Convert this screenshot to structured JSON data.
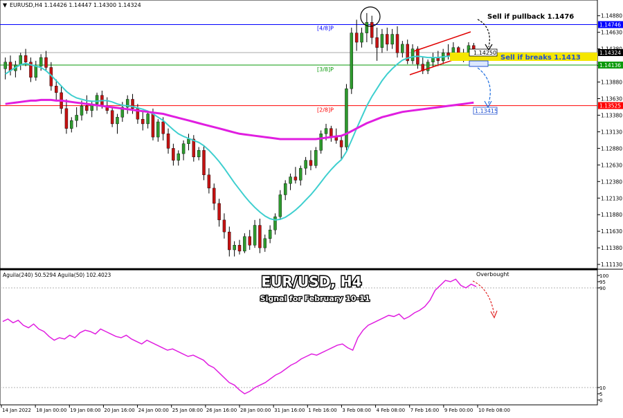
{
  "colors": {
    "bull": "#2e9a2e",
    "bear": "#c41212",
    "ema_fast": "#3ecfcf",
    "ema_slow": "#e01ee0",
    "oscillator": "#e01ee0",
    "level_48": "#0000ff",
    "level_38": "#0a9a0a",
    "level_28": "#ff0000",
    "price_badge": "#000000",
    "highlight_yellow": "#f5e600",
    "channel": "#e00000"
  },
  "header": {
    "symbol_line": "EURUSD,H4  1.14426 1.14447 1.14300 1.14324"
  },
  "title": {
    "main": "EUR/USD, H4",
    "sub": "Signal for February 10-11"
  },
  "annotations": {
    "sell_pullback": "Sell if pullback 1.1476",
    "sell_break": "Sell if breaks 1.1413",
    "target_box": "1.14250",
    "target2_box": "1.13415",
    "overbought": "Overbought",
    "label_48": "[4/8]P",
    "label_38": "[3/8]P",
    "label_28": "[2/8]P"
  },
  "indicator": {
    "legend": "Aguila(240) 50.5294 Aguila(50) 102.4023"
  },
  "chart_data": [
    {
      "type": "candlestick",
      "name": "EURUSD H4 price",
      "ylim": [
        1.1111,
        1.1495
      ],
      "yticks": [
        "1.14880",
        "1.14630",
        "1.14380",
        "1.14130",
        "1.13880",
        "1.13630",
        "1.13380",
        "1.13130",
        "1.12880",
        "1.12630",
        "1.12380",
        "1.12130",
        "1.11880",
        "1.11630",
        "1.11380",
        "1.11130"
      ],
      "price_tags": [
        {
          "text": "1.14746",
          "value": 1.14746
        },
        {
          "text": "1.14324",
          "value": 1.14324
        },
        {
          "text": "1.14136",
          "value": 1.14136
        },
        {
          "text": "1.13525",
          "value": 1.13525
        }
      ],
      "levels": [
        {
          "label": "[4/8]P",
          "value": 1.14746
        },
        {
          "label": "[3/8]P",
          "value": 1.14136
        },
        {
          "label": "[2/8]P",
          "value": 1.13525
        }
      ],
      "xlabels": [
        "14 Jan 2022",
        "18 Jan 00:00",
        "19 Jan 08:00",
        "20 Jan 16:00",
        "24 Jan 00:00",
        "25 Jan 08:00",
        "26 Jan 16:00",
        "28 Jan 00:00",
        "31 Jan 16:00",
        "1 Feb 16:00",
        "3 Feb 08:00",
        "4 Feb 08:00",
        "7 Feb 16:00",
        "9 Feb 00:00",
        "10 Feb 08:00"
      ],
      "candles": [
        [
          1.1408,
          1.1425,
          1.1392,
          1.1418
        ],
        [
          1.1418,
          1.1428,
          1.1398,
          1.1405
        ],
        [
          1.1405,
          1.142,
          1.1395,
          1.1414
        ],
        [
          1.1414,
          1.1432,
          1.1406,
          1.1428
        ],
        [
          1.1428,
          1.1438,
          1.1412,
          1.1418
        ],
        [
          1.1418,
          1.1425,
          1.1388,
          1.1395
        ],
        [
          1.1395,
          1.142,
          1.139,
          1.1412
        ],
        [
          1.1412,
          1.143,
          1.1405,
          1.1425
        ],
        [
          1.1425,
          1.1435,
          1.1405,
          1.141
        ],
        [
          1.141,
          1.1418,
          1.1375,
          1.1382
        ],
        [
          1.1382,
          1.1392,
          1.136,
          1.1372
        ],
        [
          1.1372,
          1.1382,
          1.134,
          1.1348
        ],
        [
          1.1348,
          1.1362,
          1.131,
          1.1318
        ],
        [
          1.1318,
          1.1335,
          1.1312,
          1.133
        ],
        [
          1.133,
          1.135,
          1.132,
          1.1338
        ],
        [
          1.1338,
          1.136,
          1.133,
          1.1352
        ],
        [
          1.1352,
          1.1368,
          1.134,
          1.1345
        ],
        [
          1.1345,
          1.136,
          1.1335,
          1.1355
        ],
        [
          1.1355,
          1.1372,
          1.1345,
          1.1368
        ],
        [
          1.1368,
          1.1375,
          1.1348,
          1.1352
        ],
        [
          1.1352,
          1.1365,
          1.134,
          1.1345
        ],
        [
          1.1345,
          1.135,
          1.132,
          1.1325
        ],
        [
          1.1325,
          1.134,
          1.131,
          1.1335
        ],
        [
          1.1335,
          1.1358,
          1.1328,
          1.135
        ],
        [
          1.135,
          1.1368,
          1.134,
          1.1362
        ],
        [
          1.1362,
          1.137,
          1.134,
          1.1348
        ],
        [
          1.1348,
          1.1355,
          1.1325,
          1.1332
        ],
        [
          1.1332,
          1.1345,
          1.1315,
          1.1325
        ],
        [
          1.1325,
          1.1345,
          1.1318,
          1.134
        ],
        [
          1.134,
          1.1348,
          1.13,
          1.1305
        ],
        [
          1.1305,
          1.1332,
          1.1298,
          1.1328
        ],
        [
          1.1328,
          1.1335,
          1.13,
          1.131
        ],
        [
          1.131,
          1.1318,
          1.128,
          1.1288
        ],
        [
          1.1288,
          1.1295,
          1.1262,
          1.127
        ],
        [
          1.127,
          1.1285,
          1.1262,
          1.128
        ],
        [
          1.128,
          1.13,
          1.127,
          1.1295
        ],
        [
          1.1295,
          1.131,
          1.1285,
          1.1302
        ],
        [
          1.1302,
          1.1308,
          1.1268,
          1.1275
        ],
        [
          1.1275,
          1.129,
          1.127,
          1.1285
        ],
        [
          1.1285,
          1.1292,
          1.124,
          1.1248
        ],
        [
          1.1248,
          1.1258,
          1.122,
          1.1228
        ],
        [
          1.1228,
          1.1235,
          1.1195,
          1.1205
        ],
        [
          1.1205,
          1.1212,
          1.117,
          1.118
        ],
        [
          1.118,
          1.119,
          1.1152,
          1.1162
        ],
        [
          1.1162,
          1.117,
          1.1125,
          1.1135
        ],
        [
          1.1135,
          1.1148,
          1.1125,
          1.1142
        ],
        [
          1.1142,
          1.115,
          1.1128,
          1.1133
        ],
        [
          1.1133,
          1.116,
          1.113,
          1.1155
        ],
        [
          1.1155,
          1.1165,
          1.1135,
          1.1142
        ],
        [
          1.1142,
          1.118,
          1.1138,
          1.1172
        ],
        [
          1.1172,
          1.1182,
          1.113,
          1.1138
        ],
        [
          1.1138,
          1.1158,
          1.1132,
          1.1152
        ],
        [
          1.1152,
          1.1172,
          1.1145,
          1.1165
        ],
        [
          1.1165,
          1.119,
          1.1158,
          1.1185
        ],
        [
          1.1185,
          1.1225,
          1.118,
          1.1218
        ],
        [
          1.1218,
          1.124,
          1.121,
          1.1235
        ],
        [
          1.1235,
          1.125,
          1.1225,
          1.1245
        ],
        [
          1.1245,
          1.126,
          1.1235,
          1.124
        ],
        [
          1.124,
          1.1262,
          1.1232,
          1.1258
        ],
        [
          1.1258,
          1.1275,
          1.1248,
          1.127
        ],
        [
          1.127,
          1.1285,
          1.1255,
          1.1262
        ],
        [
          1.1262,
          1.129,
          1.1258,
          1.1285
        ],
        [
          1.1285,
          1.1315,
          1.128,
          1.131
        ],
        [
          1.131,
          1.1325,
          1.13,
          1.1318
        ],
        [
          1.1318,
          1.1322,
          1.1298,
          1.1305
        ],
        [
          1.1305,
          1.1318,
          1.1295,
          1.13
        ],
        [
          1.13,
          1.1308,
          1.127,
          1.129
        ],
        [
          1.129,
          1.1385,
          1.1285,
          1.1378
        ],
        [
          1.1378,
          1.147,
          1.137,
          1.1462
        ],
        [
          1.1462,
          1.1482,
          1.1435,
          1.1448
        ],
        [
          1.1448,
          1.147,
          1.144,
          1.1462
        ],
        [
          1.1462,
          1.1492,
          1.1448,
          1.1478
        ],
        [
          1.1478,
          1.1488,
          1.1445,
          1.1455
        ],
        [
          1.1455,
          1.147,
          1.142,
          1.144
        ],
        [
          1.144,
          1.1468,
          1.1432,
          1.146
        ],
        [
          1.146,
          1.147,
          1.1435,
          1.1445
        ],
        [
          1.1445,
          1.1468,
          1.1438,
          1.146
        ],
        [
          1.146,
          1.1472,
          1.1425,
          1.1432
        ],
        [
          1.1432,
          1.145,
          1.1425,
          1.1445
        ],
        [
          1.1445,
          1.1452,
          1.1415,
          1.142
        ],
        [
          1.142,
          1.1445,
          1.1415,
          1.1438
        ],
        [
          1.1438,
          1.1442,
          1.1408,
          1.1415
        ],
        [
          1.1415,
          1.1425,
          1.14,
          1.1405
        ],
        [
          1.1405,
          1.1422,
          1.14,
          1.1418
        ],
        [
          1.1418,
          1.1432,
          1.141,
          1.1425
        ],
        [
          1.1425,
          1.1435,
          1.1412,
          1.142
        ],
        [
          1.142,
          1.1438,
          1.1415,
          1.1432
        ],
        [
          1.1432,
          1.1445,
          1.1422,
          1.1428
        ],
        [
          1.1428,
          1.1448,
          1.142,
          1.144
        ],
        [
          1.144,
          1.1442,
          1.142,
          1.1425
        ],
        [
          1.1425,
          1.1438,
          1.1418,
          1.1432
        ],
        [
          1.1432,
          1.1448,
          1.1428,
          1.1443
        ],
        [
          1.1443,
          1.1447,
          1.143,
          1.1432
        ]
      ],
      "ema_fast": [
        1.14,
        1.1405,
        1.141,
        1.1414,
        1.1416,
        1.1414,
        1.1412,
        1.141,
        1.1405,
        1.1398,
        1.139,
        1.1382,
        1.1374,
        1.1368,
        1.1364,
        1.1362,
        1.136,
        1.1359,
        1.1359,
        1.136,
        1.136,
        1.1358,
        1.1355,
        1.1353,
        1.1352,
        1.1351,
        1.1349,
        1.1347,
        1.1344,
        1.134,
        1.1335,
        1.133,
        1.1323,
        1.1316,
        1.131,
        1.1306,
        1.1303,
        1.13,
        1.1297,
        1.1292,
        1.1285,
        1.1277,
        1.1268,
        1.1258,
        1.1247,
        1.1236,
        1.1226,
        1.1216,
        1.1207,
        1.1199,
        1.1192,
        1.1186,
        1.1182,
        1.118,
        1.1181,
        1.1184,
        1.1189,
        1.1195,
        1.1202,
        1.121,
        1.1218,
        1.1227,
        1.1237,
        1.1247,
        1.1256,
        1.1264,
        1.1271,
        1.1283,
        1.13,
        1.1318,
        1.1335,
        1.1352,
        1.1366,
        1.1378,
        1.139,
        1.14,
        1.1408,
        1.1415,
        1.1421,
        1.1424,
        1.1426,
        1.1427,
        1.1426,
        1.1425,
        1.1425,
        1.1425,
        1.1426,
        1.1427,
        1.1428,
        1.1428,
        1.1428,
        1.1429,
        1.143
      ],
      "ema_slow": [
        1.1355,
        1.1356,
        1.1357,
        1.1358,
        1.1359,
        1.136,
        1.136,
        1.1361,
        1.1361,
        1.1361,
        1.136,
        1.136,
        1.1359,
        1.1358,
        1.1357,
        1.1356,
        1.1355,
        1.1354,
        1.1353,
        1.1352,
        1.1351,
        1.135,
        1.1349,
        1.1348,
        1.1347,
        1.1346,
        1.1345,
        1.1344,
        1.1343,
        1.1342,
        1.1341,
        1.134,
        1.1338,
        1.1336,
        1.1334,
        1.1332,
        1.133,
        1.1328,
        1.1326,
        1.1324,
        1.1322,
        1.132,
        1.1318,
        1.1316,
        1.1314,
        1.1312,
        1.131,
        1.1309,
        1.1308,
        1.1307,
        1.1306,
        1.1305,
        1.1304,
        1.1303,
        1.1302,
        1.1302,
        1.1302,
        1.1302,
        1.1302,
        1.1302,
        1.1302,
        1.1302,
        1.1303,
        1.1304,
        1.1305,
        1.1306,
        1.1307,
        1.131,
        1.1314,
        1.1318,
        1.1322,
        1.1326,
        1.1329,
        1.1332,
        1.1335,
        1.1337,
        1.1339,
        1.1341,
        1.1343,
        1.1344,
        1.1345,
        1.1346,
        1.1347,
        1.1348,
        1.1349,
        1.135,
        1.1351,
        1.1352,
        1.1353,
        1.1354,
        1.1355,
        1.1356,
        1.1357
      ]
    },
    {
      "type": "line",
      "name": "Aguila oscillator",
      "ylim": [
        0,
        100
      ],
      "yticks": [
        "100",
        "95",
        "90",
        "10",
        "5",
        "0"
      ],
      "values": [
        63,
        65,
        62,
        64,
        60,
        58,
        61,
        57,
        55,
        51,
        48,
        50,
        49,
        52,
        50,
        54,
        56,
        55,
        53,
        57,
        55,
        53,
        51,
        50,
        52,
        49,
        47,
        45,
        48,
        46,
        44,
        42,
        40,
        41,
        39,
        37,
        35,
        36,
        34,
        32,
        28,
        26,
        22,
        18,
        14,
        12,
        8,
        5,
        7,
        10,
        12,
        14,
        17,
        20,
        22,
        25,
        28,
        30,
        33,
        35,
        37,
        36,
        38,
        40,
        42,
        44,
        45,
        42,
        40,
        50,
        56,
        60,
        62,
        64,
        66,
        68,
        67,
        69,
        65,
        67,
        70,
        72,
        75,
        80,
        88,
        92,
        96,
        95,
        97,
        92,
        90,
        93,
        91
      ]
    }
  ]
}
